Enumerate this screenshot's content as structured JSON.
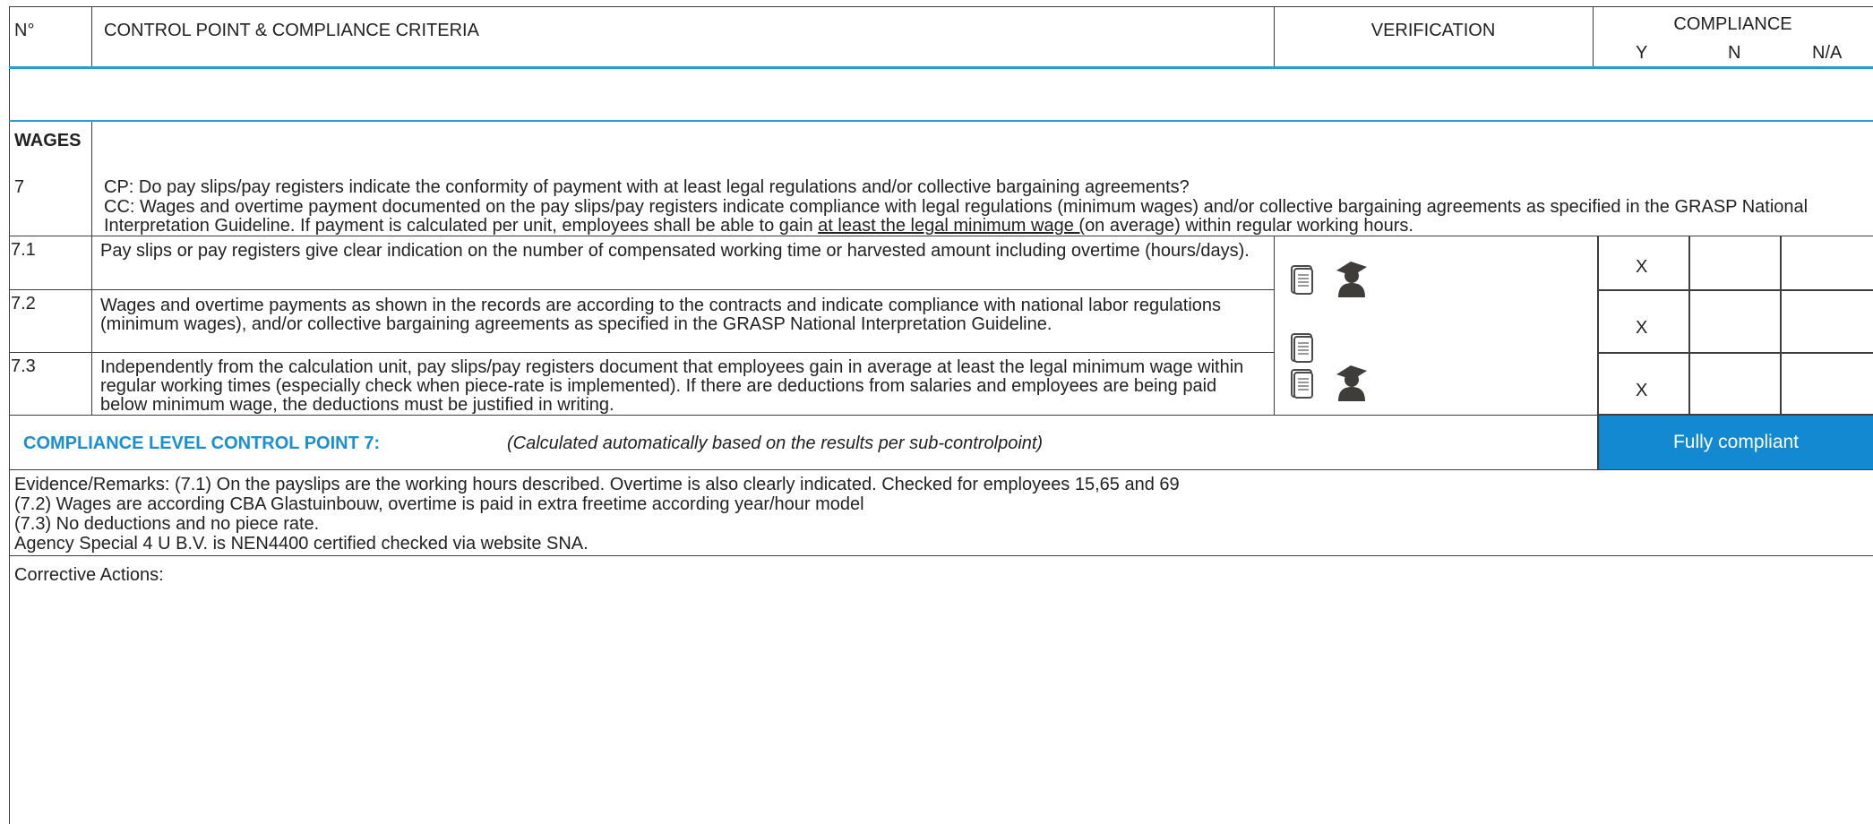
{
  "header": {
    "no": "N°",
    "control_point": "CONTROL POINT & COMPLIANCE CRITERIA",
    "verification": "VERIFICATION",
    "compliance": "COMPLIANCE",
    "y": "Y",
    "n": "N",
    "na": "N/A"
  },
  "section": {
    "title": "WAGES"
  },
  "cp": {
    "number": "7",
    "question": "CP: Do pay slips/pay registers indicate the conformity of payment with at least legal regulations and/or collective bargaining agreements?",
    "criteria_part1": "CC: Wages and overtime payment documented on the pay slips/pay registers indicate compliance with legal regulations (minimum wages) and/or collective bargaining agreements as specified in the GRASP National Interpretation Guideline. If payment is calculated per unit, employees shall be able to gain ",
    "criteria_underlined": "at least the legal minimum wage (",
    "criteria_part2": "on average) within regular working hours."
  },
  "subpoints": [
    {
      "number": "7.1",
      "text": "Pay slips or pay registers give clear indication on the number of compensated working time or harvested amount including overtime (hours/days).",
      "verification_icons": [
        "document-icon",
        "interview-person-icon"
      ],
      "mark": "X"
    },
    {
      "number": "7.2",
      "text": "Wages and overtime payments as shown in the records are according to the contracts and indicate compliance with national labor regulations (minimum wages), and/or collective bargaining agreements as specified in the GRASP National Interpretation Guideline.",
      "verification_icons": [
        "document-icon"
      ],
      "mark": "X"
    },
    {
      "number": "7.3",
      "text": "Independently from the calculation unit, pay slips/pay registers document that employees gain in average at least the legal minimum wage within regular working times (especially check when piece-rate is implemented). If there are deductions from salaries and employees are being paid below minimum wage, the deductions must be justified in writing.",
      "verification_icons": [
        "document-icon",
        "interview-person-icon"
      ],
      "mark": "X"
    }
  ],
  "compliance_level": {
    "label": "COMPLIANCE LEVEL CONTROL POINT 7:",
    "note": "(Calculated automatically based on the results per sub-controlpoint)",
    "result": "Fully compliant"
  },
  "evidence": {
    "lines": [
      "Evidence/Remarks: (7.1) On the payslips are the working hours described. Overtime is also clearly indicated. Checked for employees 15,65 and 69",
      "(7.2) Wages are according CBA Glastuinbouw, overtime is paid in extra freetime according year/hour model",
      "(7.3) No deductions and no piece rate.",
      "Agency Special 4 U B.V. is NEN4400 certified checked via website SNA."
    ]
  },
  "corrective": {
    "label": "Corrective Actions:"
  },
  "colors": {
    "accent_blue": "#2b9ad8",
    "banner_blue": "#1289d1",
    "label_blue": "#1a8fd4"
  }
}
